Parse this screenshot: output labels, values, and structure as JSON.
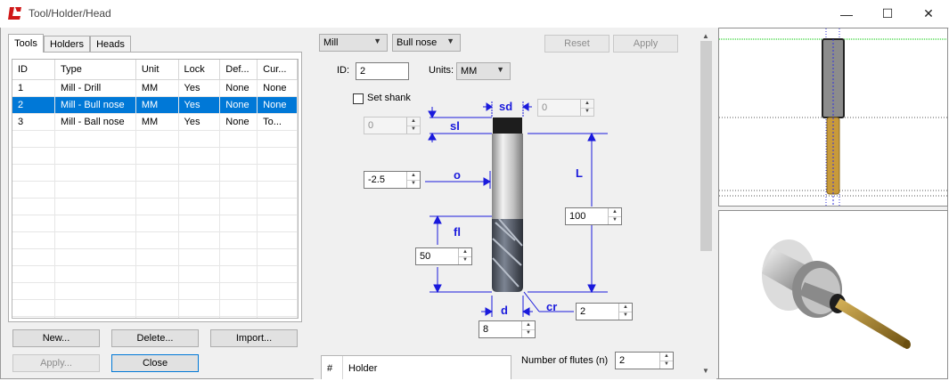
{
  "window": {
    "title": "Tool/Holder/Head",
    "controls": {
      "minimize": "—",
      "maximize": "☐",
      "close": "✕"
    }
  },
  "tabs": [
    "Tools",
    "Holders",
    "Heads"
  ],
  "tools_table": {
    "columns": [
      "ID",
      "Type",
      "Unit",
      "Lock",
      "Def...",
      "Cur..."
    ],
    "rows": [
      [
        "1",
        "Mill - Drill",
        "MM",
        "Yes",
        "None",
        "None"
      ],
      [
        "2",
        "Mill - Bull nose",
        "MM",
        "Yes",
        "None",
        "None"
      ],
      [
        "3",
        "Mill - Ball nose",
        "MM",
        "Yes",
        "None",
        "To..."
      ]
    ],
    "selected_row": 1
  },
  "buttons": {
    "new": "New...",
    "delete": "Delete...",
    "import": "Import...",
    "apply_left": "Apply...",
    "close": "Close",
    "reset": "Reset",
    "apply": "Apply"
  },
  "tool_editor": {
    "type_select": "Mill",
    "subtype_select": "Bull nose",
    "id_label": "ID:",
    "id_value": "2",
    "units_label": "Units:",
    "units_value": "MM",
    "set_shank_label": "Set shank",
    "set_shank_checked": false,
    "dims": {
      "sd": {
        "label": "sd",
        "value": "0"
      },
      "sl": {
        "label": "sl",
        "value": "0"
      },
      "o": {
        "label": "o",
        "value": "-2.5"
      },
      "L": {
        "label": "L",
        "value": "100"
      },
      "fl": {
        "label": "fl",
        "value": "50"
      },
      "d": {
        "label": "d",
        "value": "8"
      },
      "cr": {
        "label": "cr",
        "value": "2"
      }
    },
    "flutes_label": "Number of flutes (n)",
    "flutes_value": "2",
    "holder_table": {
      "columns": [
        "#",
        "Holder"
      ]
    }
  },
  "colors": {
    "selection": "#0078d7",
    "dimension": "#1a1adc",
    "green_line": "#00c800"
  }
}
